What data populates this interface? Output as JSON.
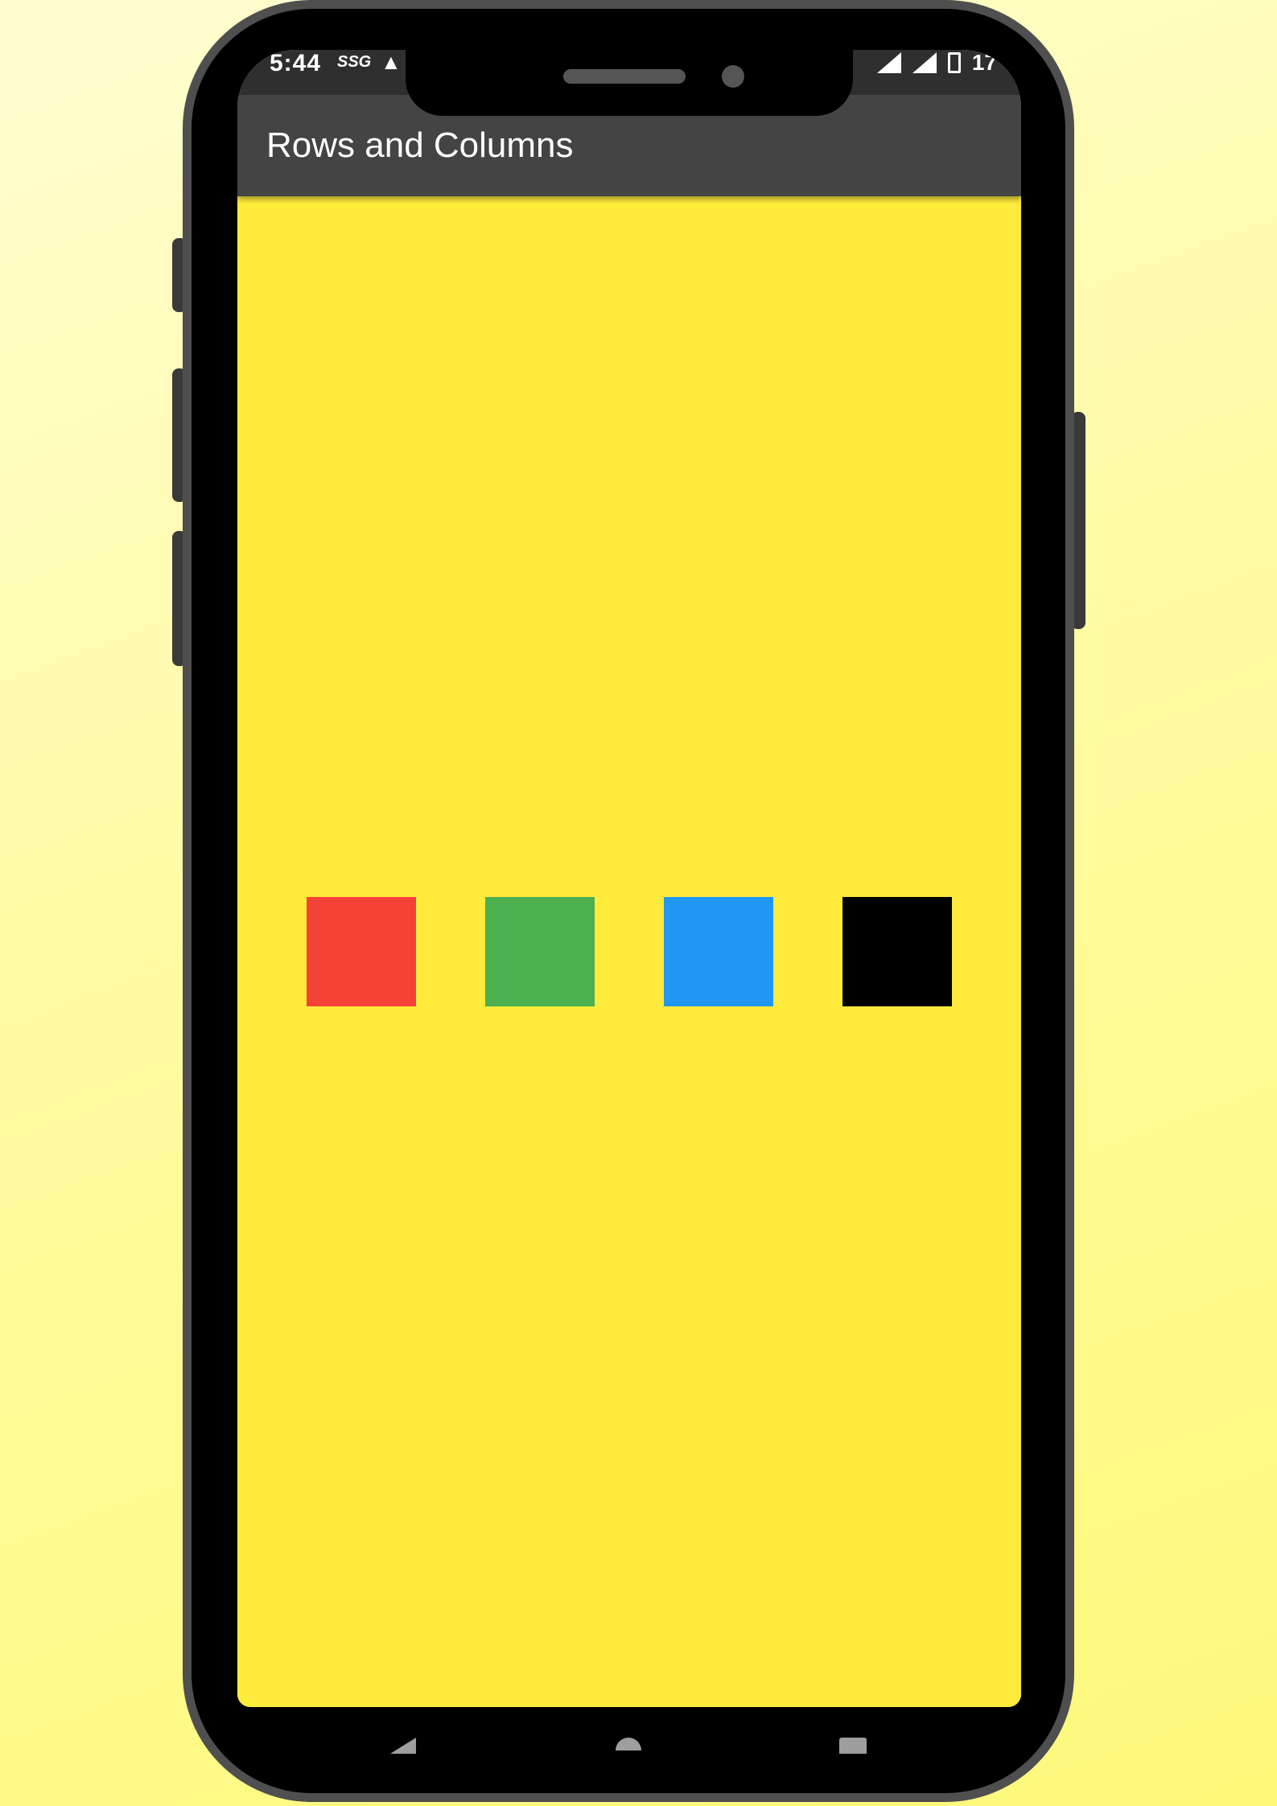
{
  "status_bar": {
    "time": "5:44",
    "carrier": "SSG",
    "battery": "17"
  },
  "app_bar": {
    "title": "Rows and Columns",
    "color": "#444444"
  },
  "body": {
    "background": "#ffeb3b",
    "boxes": [
      {
        "name": "red",
        "color": "#f44336"
      },
      {
        "name": "green",
        "color": "#4caf50"
      },
      {
        "name": "blue",
        "color": "#2196f3"
      },
      {
        "name": "black",
        "color": "#000000"
      }
    ]
  },
  "nav_bar": {
    "icons": [
      "back-icon",
      "home-icon",
      "recent-apps-icon"
    ]
  }
}
